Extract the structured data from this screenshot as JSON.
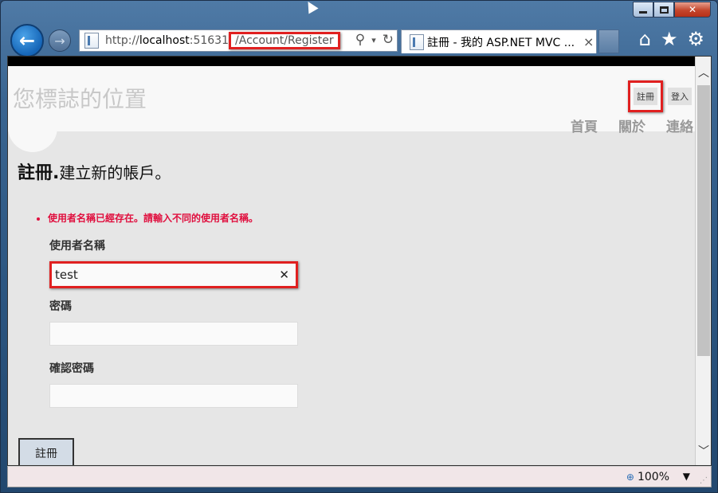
{
  "browser": {
    "address_prefix": "http://",
    "address_host": "localhost",
    "address_port": ":5163",
    "address_port_tail": "1",
    "address_path": "/Account/Register",
    "tab_title": "註冊 - 我的 ASP.NET MVC ...",
    "tab_close": "×",
    "zoom": "100%",
    "icons": [
      "back-arrow-icon",
      "forward-arrow-icon",
      "page-icon",
      "search-icon",
      "dropdown-icon",
      "refresh-icon",
      "home-icon",
      "favorites-star-icon",
      "settings-gear-icon"
    ]
  },
  "site": {
    "logo": "您標誌的位置",
    "register_link": "註冊",
    "login_link": "登入",
    "menu": [
      "首頁",
      "關於",
      "連絡"
    ]
  },
  "page": {
    "title_bold": "註冊.",
    "title_sub": "建立新的帳戶。",
    "error": "使用者名稱已經存在。請輸入不同的使用者名稱。",
    "username_label": "使用者名稱",
    "username_value": "test",
    "password_label": "密碼",
    "confirm_label": "確認密碼",
    "submit_label": "註冊"
  },
  "colors": {
    "error": "#e0103f",
    "highlight_box": "#e02020"
  }
}
